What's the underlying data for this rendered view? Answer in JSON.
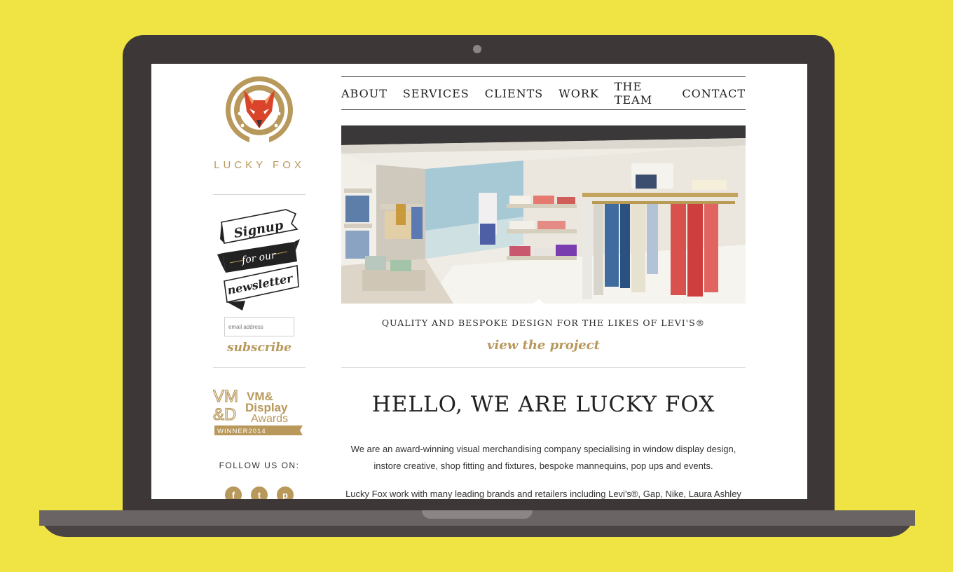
{
  "colors": {
    "background": "#efe443",
    "laptop_body": "#3d3837",
    "accent_gold": "#b8985b",
    "text_dark": "#222222"
  },
  "sidebar": {
    "brand": "LUCKY FOX",
    "signup_lines": [
      "Signup",
      "for our",
      "newsletter"
    ],
    "email_placeholder": "email address",
    "subscribe_label": "subscribe",
    "award": {
      "mark1": "VM",
      "mark2": "&D",
      "title1": "VM&",
      "title2": "Display",
      "title3": "Awards",
      "ribbon": "WINNER2014"
    },
    "follow_label": "FOLLOW US ON:",
    "social_icons": [
      "facebook-icon",
      "twitter-icon",
      "pinterest-icon"
    ]
  },
  "nav": {
    "items": [
      "ABOUT",
      "SERVICES",
      "CLIENTS",
      "WORK",
      "THE TEAM",
      "CONTACT"
    ]
  },
  "hero": {
    "caption": "QUALITY AND BESPOKE DESIGN FOR THE LIKES OF LEVI'S®",
    "cta": "view the project"
  },
  "content": {
    "heading": "HELLO, WE ARE LUCKY FOX",
    "intro_line1": "We are an award-winning visual merchandising company specialising in window display design,",
    "intro_line2": "instore creative, shop fitting and fixtures, bespoke mannequins, pop ups and events.",
    "intro_line3": "Lucky Fox work with many leading brands and retailers including Levi's®, Gap, Nike, Laura Ashley"
  }
}
